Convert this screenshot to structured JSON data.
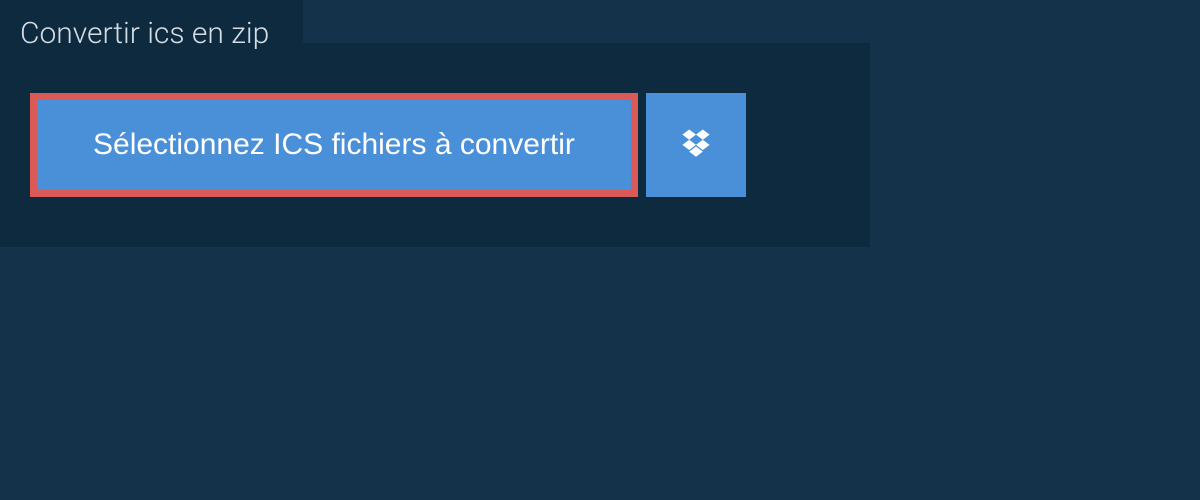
{
  "tab": {
    "title": "Convertir ics en zip"
  },
  "actions": {
    "select_label": "Sélectionnez ICS fichiers à convertir",
    "dropbox_icon": "dropbox-icon"
  },
  "colors": {
    "bg": "#14324a",
    "panel": "#0e2a3f",
    "accent": "#4a90d9",
    "highlight_border": "#d95a57"
  }
}
